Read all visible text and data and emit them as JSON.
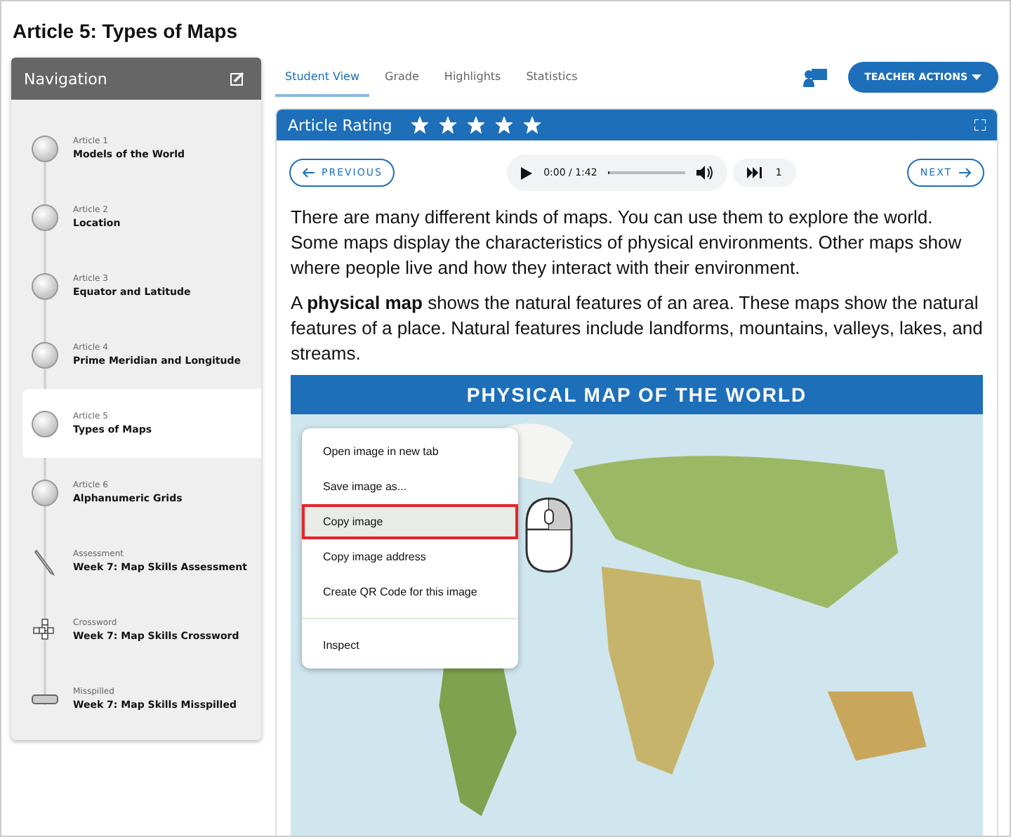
{
  "page_title": "Article 5: Types of Maps",
  "navigation": {
    "title": "Navigation",
    "items": [
      {
        "kind": "article",
        "label": "Article 1",
        "title": "Models of the World",
        "selected": false
      },
      {
        "kind": "article",
        "label": "Article 2",
        "title": "Location",
        "selected": false
      },
      {
        "kind": "article",
        "label": "Article 3",
        "title": "Equator and Latitude",
        "selected": false
      },
      {
        "kind": "article",
        "label": "Article 4",
        "title": "Prime Meridian and Longitude",
        "selected": false
      },
      {
        "kind": "article",
        "label": "Article 5",
        "title": "Types of Maps",
        "selected": true
      },
      {
        "kind": "article",
        "label": "Article 6",
        "title": "Alphanumeric Grids",
        "selected": false
      },
      {
        "kind": "assessment",
        "label": "Assessment",
        "title": "Week 7: Map Skills Assessment",
        "selected": false
      },
      {
        "kind": "crossword",
        "label": "Crossword",
        "title": "Week 7: Map Skills Crossword",
        "selected": false
      },
      {
        "kind": "misspelled",
        "label": "Misspilled",
        "title": "Week 7: Map Skills Misspilled",
        "selected": false
      }
    ]
  },
  "tabs": [
    {
      "label": "Student View",
      "selected": true
    },
    {
      "label": "Grade",
      "selected": false
    },
    {
      "label": "Highlights",
      "selected": false
    },
    {
      "label": "Statistics",
      "selected": false
    }
  ],
  "teacher_actions": "TEACHER ACTIONS",
  "article": {
    "title": "Article Rating",
    "stars": 5,
    "previous": "PREVIOUS",
    "next": "NEXT",
    "audio": {
      "time": "0:00 / 1:42",
      "level": 0.02,
      "skip_count": "1"
    },
    "paragraphs": [
      "There are many different kinds of maps. You can use them to explore the world. Some maps display the characteristics of physical environments. Other maps show where people live and how they interact with their environment.",
      "A **physical map** shows the natural features of an area. These maps show the natural features of a place. Natural features include landforms, mountains, valleys, lakes, and streams."
    ],
    "map_title": "PHYSICAL MAP OF THE WORLD"
  },
  "context_menu": [
    {
      "label": "Open image in new tab",
      "selected": false,
      "separator_before": false
    },
    {
      "label": "Save image as...",
      "selected": false,
      "separator_before": false
    },
    {
      "label": "Copy image",
      "selected": true,
      "separator_before": false
    },
    {
      "label": "Copy image address",
      "selected": false,
      "separator_before": false
    },
    {
      "label": "Create QR Code for this image",
      "selected": false,
      "separator_before": false
    },
    {
      "label": "Inspect",
      "selected": false,
      "separator_before": true
    }
  ]
}
